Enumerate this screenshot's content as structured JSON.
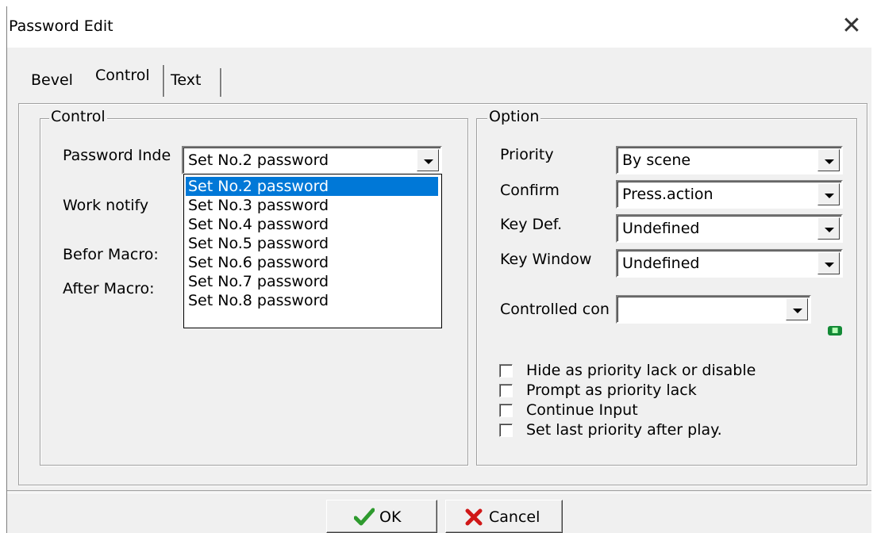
{
  "window": {
    "title": "Password Edit",
    "close_glyph": "✕"
  },
  "tabs": [
    "Bevel",
    "Control",
    "Text"
  ],
  "control_group": {
    "legend": "Control",
    "password_index_label": "Password Inde",
    "password_index_value": "Set No.2 password",
    "work_notify_label": "Work notify",
    "before_macro_label": "Befor Macro:",
    "after_macro_label": "After Macro:",
    "dropdown_options": [
      "Set No.2 password",
      "Set No.3 password",
      "Set No.4 password",
      "Set No.5 password",
      "Set No.6 password",
      "Set No.7 password",
      "Set No.8 password"
    ],
    "selected_option": "Set No.2 password"
  },
  "option_group": {
    "legend": "Option",
    "priority_label": "Priority",
    "priority_value": "By scene",
    "confirm_label": "Confirm",
    "confirm_value": "Press.action",
    "key_def_label": "Key Def.",
    "key_def_value": "Undefined",
    "key_window_label": "Key Window",
    "key_window_value": "Undefined",
    "controlled_label": "Controlled con",
    "controlled_value": "",
    "badge_icon": "green-indicator-icon",
    "checkboxes": [
      {
        "label": "Hide as priority lack or disable",
        "checked": false
      },
      {
        "label": "Prompt as priority lack",
        "checked": false
      },
      {
        "label": "Continue Input",
        "checked": false
      },
      {
        "label": "Set last priority after play.",
        "checked": false
      }
    ]
  },
  "buttons": {
    "ok": "OK",
    "ok_icon": "checkmark-icon",
    "ok_icon_color": "#2e9a2e",
    "cancel": "Cancel",
    "cancel_icon": "x-icon",
    "cancel_icon_color": "#d01818"
  },
  "colors": {
    "selection": "#0078d7",
    "dialog_bg": "#f0f0f0"
  }
}
